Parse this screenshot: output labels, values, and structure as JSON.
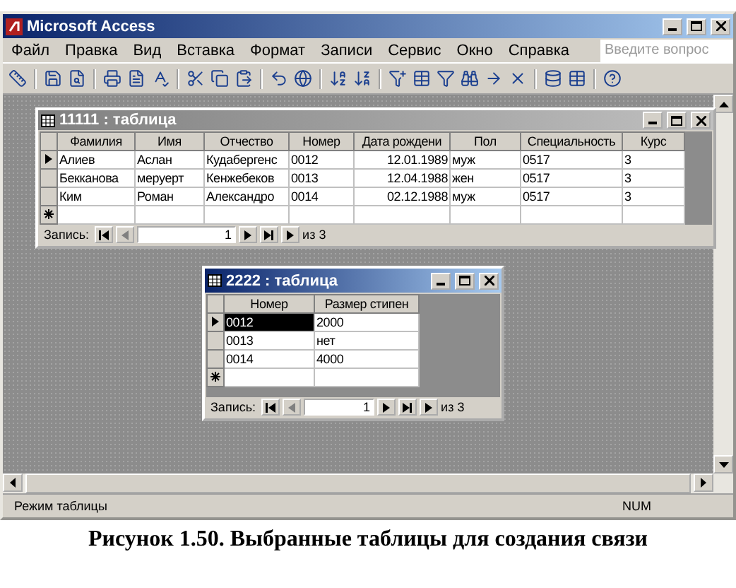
{
  "window": {
    "title": "Microsoft Access"
  },
  "menu": [
    "Файл",
    "Правка",
    "Вид",
    "Вставка",
    "Формат",
    "Записи",
    "Сервис",
    "Окно",
    "Справка"
  ],
  "help_search": {
    "placeholder": "Введите вопрос"
  },
  "tables": [
    {
      "title": "11111 : таблица",
      "active": false,
      "columns": [
        {
          "label": "Фамилия",
          "kind": "text"
        },
        {
          "label": "Имя",
          "kind": "text"
        },
        {
          "label": "Отчество",
          "kind": "text"
        },
        {
          "label": "Номер",
          "kind": "text"
        },
        {
          "label": "Дата рождени",
          "kind": "date"
        },
        {
          "label": "Пол",
          "kind": "text"
        },
        {
          "label": "Специальность",
          "kind": "text"
        },
        {
          "label": "Курс",
          "kind": "text"
        }
      ],
      "rows": [
        {
          "current": true,
          "cells": [
            {
              "text": "Алиев",
              "selected": false
            },
            {
              "text": "Аслан",
              "selected": false
            },
            {
              "text": "Кудабергенс",
              "selected": false
            },
            {
              "text": "0012",
              "selected": false
            },
            {
              "text": "12.01.1989",
              "selected": false
            },
            {
              "text": "муж",
              "selected": false
            },
            {
              "text": "0517",
              "selected": false
            },
            {
              "text": "3",
              "selected": false
            }
          ]
        },
        {
          "current": false,
          "cells": [
            {
              "text": "Бекканова",
              "selected": false
            },
            {
              "text": "меруерт",
              "selected": false
            },
            {
              "text": "Кенжебеков",
              "selected": false
            },
            {
              "text": "0013",
              "selected": false
            },
            {
              "text": "12.04.1988",
              "selected": false
            },
            {
              "text": "жен",
              "selected": false
            },
            {
              "text": "0517",
              "selected": false
            },
            {
              "text": "3",
              "selected": false
            }
          ]
        },
        {
          "current": false,
          "cells": [
            {
              "text": "Ким",
              "selected": false
            },
            {
              "text": "Роман",
              "selected": false
            },
            {
              "text": "Александро",
              "selected": false
            },
            {
              "text": "0014",
              "selected": false
            },
            {
              "text": "02.12.1988",
              "selected": false
            },
            {
              "text": "муж",
              "selected": false
            },
            {
              "text": "0517",
              "selected": false
            },
            {
              "text": "3",
              "selected": false
            }
          ]
        }
      ],
      "navigator": {
        "label": "Запись:",
        "record": "1",
        "total": "из 3"
      }
    },
    {
      "title": "2222 : таблица",
      "active": true,
      "columns": [
        {
          "label": "Номер",
          "kind": "text"
        },
        {
          "label": "Размер стипен",
          "kind": "text"
        }
      ],
      "rows": [
        {
          "current": true,
          "cells": [
            {
              "text": "0012",
              "selected": true
            },
            {
              "text": "2000",
              "selected": false
            }
          ]
        },
        {
          "current": false,
          "cells": [
            {
              "text": "0013",
              "selected": false
            },
            {
              "text": "нет",
              "selected": false
            }
          ]
        },
        {
          "current": false,
          "cells": [
            {
              "text": "0014",
              "selected": false
            },
            {
              "text": "4000",
              "selected": false
            }
          ]
        }
      ],
      "navigator": {
        "label": "Запись:",
        "record": "1",
        "total": "из 3"
      }
    }
  ],
  "status_bar": {
    "mode": "Режим таблицы",
    "num": "NUM"
  },
  "caption": "Рисунок 1.50. Выбранные таблицы для создания связи"
}
